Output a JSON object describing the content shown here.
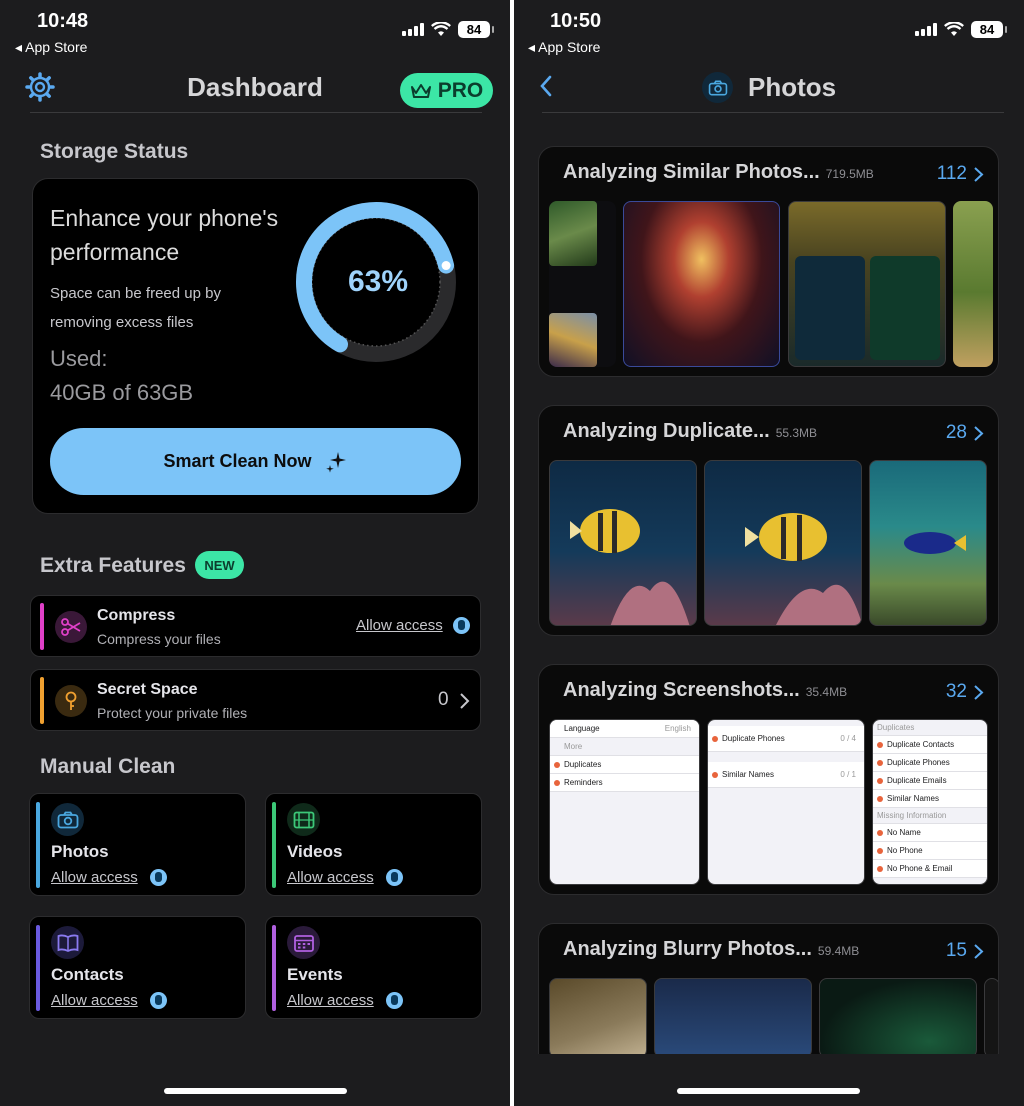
{
  "left": {
    "status": {
      "time": "10:48",
      "back_app": "App Store",
      "battery": "84"
    },
    "nav": {
      "title": "Dashboard",
      "pro_label": "PRO"
    },
    "storage": {
      "section_title": "Storage Status",
      "headline": "Enhance your phone's performance",
      "subtext": "Space can be freed up by removing excess files",
      "used_label": "Used:",
      "used_value": "40GB of 63GB",
      "percent_text": "63%",
      "percent": 0.63,
      "button_label": "Smart Clean Now"
    },
    "extra": {
      "section_title": "Extra Features",
      "badge": "NEW",
      "items": [
        {
          "title": "Compress",
          "subtitle": "Compress your files",
          "action": "Allow access",
          "icon": "scissors-icon",
          "color": "#e040c8"
        },
        {
          "title": "Secret Space",
          "subtitle": "Protect your private files",
          "count": "0",
          "icon": "key-icon",
          "color": "#f0a030"
        }
      ]
    },
    "manual": {
      "section_title": "Manual Clean",
      "items": [
        {
          "title": "Photos",
          "action": "Allow access",
          "icon": "camera-icon",
          "color": "#4aa8e0"
        },
        {
          "title": "Videos",
          "action": "Allow access",
          "icon": "film-icon",
          "color": "#3cc878"
        },
        {
          "title": "Contacts",
          "action": "Allow access",
          "icon": "book-icon",
          "color": "#6a5ae0"
        },
        {
          "title": "Events",
          "action": "Allow access",
          "icon": "calendar-icon",
          "color": "#b060e0"
        }
      ]
    }
  },
  "right": {
    "status": {
      "time": "10:50",
      "back_app": "App Store",
      "battery": "84"
    },
    "nav": {
      "title": "Photos"
    },
    "groups": [
      {
        "title": "Analyzing Similar Photos...",
        "size": "719.5MB",
        "count": "112"
      },
      {
        "title": "Analyzing Duplicate...",
        "size": "55.3MB",
        "count": "28"
      },
      {
        "title": "Analyzing Screenshots...",
        "size": "35.4MB",
        "count": "32"
      },
      {
        "title": "Analyzing Blurry Photos...",
        "size": "59.4MB",
        "count": "15"
      }
    ],
    "screenshot_thumbs": {
      "a": [
        "Language",
        "Duplicates",
        "Reminders"
      ],
      "a_right": "English",
      "a_more": "More",
      "b": [
        "Duplicate Phones",
        "Similar Names"
      ],
      "b_counts": [
        "0 / 4",
        "0 / 1"
      ],
      "c_header": "Duplicates",
      "c": [
        "Duplicate Contacts",
        "Duplicate Phones",
        "Duplicate Emails",
        "Similar Names"
      ],
      "c_header2": "Missing Information",
      "c2": [
        "No Name",
        "No Phone",
        "No Phone & Email"
      ]
    }
  }
}
